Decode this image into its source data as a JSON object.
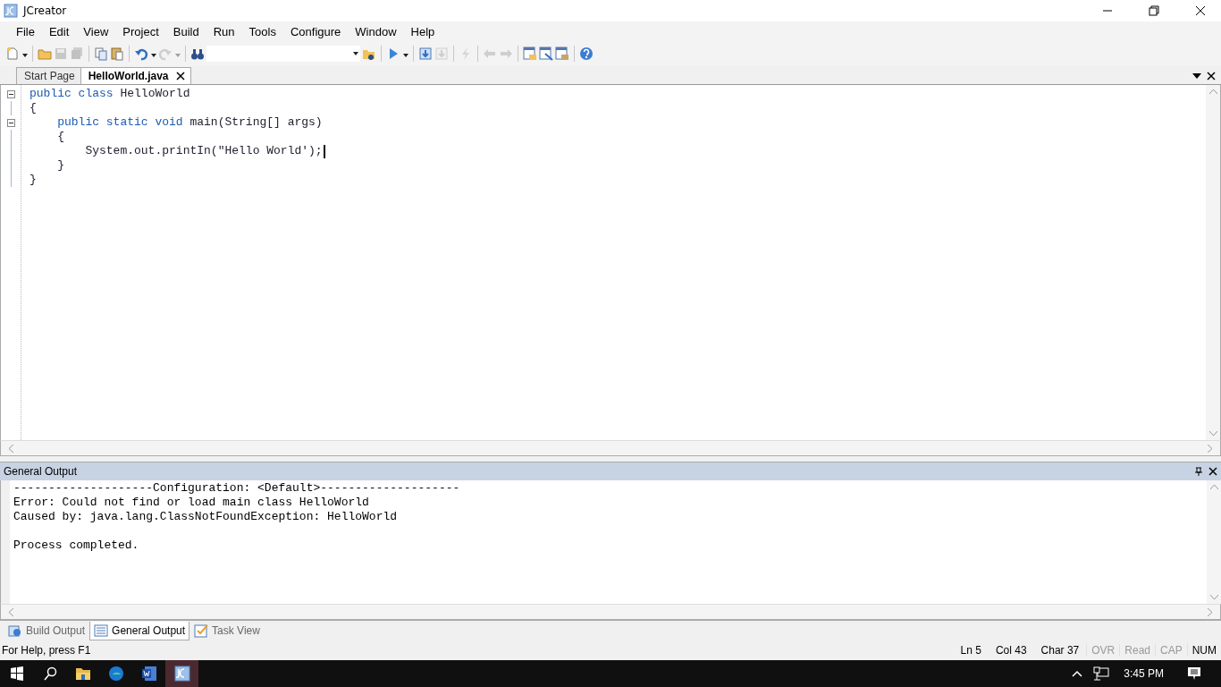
{
  "window": {
    "title": "JCreator"
  },
  "menu": [
    "File",
    "Edit",
    "View",
    "Project",
    "Build",
    "Run",
    "Tools",
    "Configure",
    "Window",
    "Help"
  ],
  "toolbar": [
    {
      "kind": "new",
      "disabled": false,
      "dropdown": true
    },
    {
      "kind": "separator"
    },
    {
      "kind": "open",
      "disabled": false
    },
    {
      "kind": "save",
      "disabled": true
    },
    {
      "kind": "save-all",
      "disabled": true
    },
    {
      "kind": "separator"
    },
    {
      "kind": "copy",
      "disabled": false
    },
    {
      "kind": "paste",
      "disabled": false
    },
    {
      "kind": "separator"
    },
    {
      "kind": "undo",
      "disabled": false,
      "dropdown": true
    },
    {
      "kind": "redo",
      "disabled": true,
      "dropdown": true
    },
    {
      "kind": "separator"
    },
    {
      "kind": "find",
      "disabled": false
    },
    {
      "kind": "combo"
    },
    {
      "kind": "find-in-files",
      "disabled": false
    },
    {
      "kind": "separator"
    },
    {
      "kind": "run",
      "disabled": false,
      "dropdown": true
    },
    {
      "kind": "separator"
    },
    {
      "kind": "compile",
      "disabled": false
    },
    {
      "kind": "stop",
      "disabled": true
    },
    {
      "kind": "separator"
    },
    {
      "kind": "tool",
      "disabled": true
    },
    {
      "kind": "separator"
    },
    {
      "kind": "back",
      "disabled": true
    },
    {
      "kind": "forward",
      "disabled": true
    },
    {
      "kind": "separator"
    },
    {
      "kind": "window-a",
      "disabled": false
    },
    {
      "kind": "window-b",
      "disabled": false
    },
    {
      "kind": "window-c",
      "disabled": false
    },
    {
      "kind": "separator"
    },
    {
      "kind": "help",
      "disabled": false
    }
  ],
  "tabs": [
    {
      "label": "Start Page",
      "selected": false
    },
    {
      "label": "HelloWorld.java",
      "selected": true,
      "closable": true
    }
  ],
  "editor": {
    "lines": [
      {
        "foldable": true,
        "tokens": [
          {
            "kind": "keyword",
            "text": "public"
          },
          {
            "kind": "keyword",
            "text": " class"
          },
          {
            "kind": "plain",
            "text": " HelloWorld"
          }
        ]
      },
      {
        "foldable": false,
        "tokens": [
          {
            "kind": "plain",
            "text": "{"
          }
        ]
      },
      {
        "foldable": true,
        "tokens": [
          {
            "kind": "keyword",
            "text": "    public"
          },
          {
            "kind": "keyword",
            "text": " static"
          },
          {
            "kind": "keyword",
            "text": " void"
          },
          {
            "kind": "plain",
            "text": " main(String[] args)"
          }
        ]
      },
      {
        "foldable": false,
        "tokens": [
          {
            "kind": "plain",
            "text": "    {"
          }
        ]
      },
      {
        "foldable": false,
        "caret": true,
        "tokens": [
          {
            "kind": "plain",
            "text": "        System.out.printIn(\"Hello World');"
          }
        ]
      },
      {
        "foldable": false,
        "tokens": [
          {
            "kind": "plain",
            "text": "    }"
          }
        ]
      },
      {
        "foldable": false,
        "tokens": [
          {
            "kind": "plain",
            "text": "}"
          }
        ]
      }
    ]
  },
  "output": {
    "title": "General Output",
    "lines": [
      {
        "kind": "text",
        "text": "--------------------Configuration: <Default>--------------------"
      },
      {
        "kind": "text",
        "text": "Error: Could not find or load main class HelloWorld"
      },
      {
        "kind": "text",
        "text": "Caused by: java.lang.ClassNotFoundException: HelloWorld"
      },
      {
        "kind": "blank"
      },
      {
        "kind": "text",
        "text": "Process completed."
      }
    ]
  },
  "bottom_tabs": [
    {
      "label": "Build Output",
      "kind": "build",
      "selected": false
    },
    {
      "label": "General Output",
      "kind": "output",
      "selected": true
    },
    {
      "label": "Task View",
      "kind": "task",
      "selected": false
    }
  ],
  "status_bar": {
    "help": "For Help, press F1",
    "position": [
      "Ln 5",
      "Col 43",
      "Char 37"
    ],
    "indicators": [
      {
        "label": "OVR",
        "active": false
      },
      {
        "label": "Read",
        "active": false
      },
      {
        "label": "CAP",
        "active": false
      },
      {
        "label": "NUM",
        "active": true
      }
    ]
  },
  "taskbar": {
    "apps": [
      {
        "kind": "explorer",
        "selected": false
      },
      {
        "kind": "browser",
        "selected": false
      },
      {
        "kind": "word",
        "selected": false
      },
      {
        "kind": "jcreator",
        "selected": true
      }
    ],
    "time": "3:45 PM"
  }
}
